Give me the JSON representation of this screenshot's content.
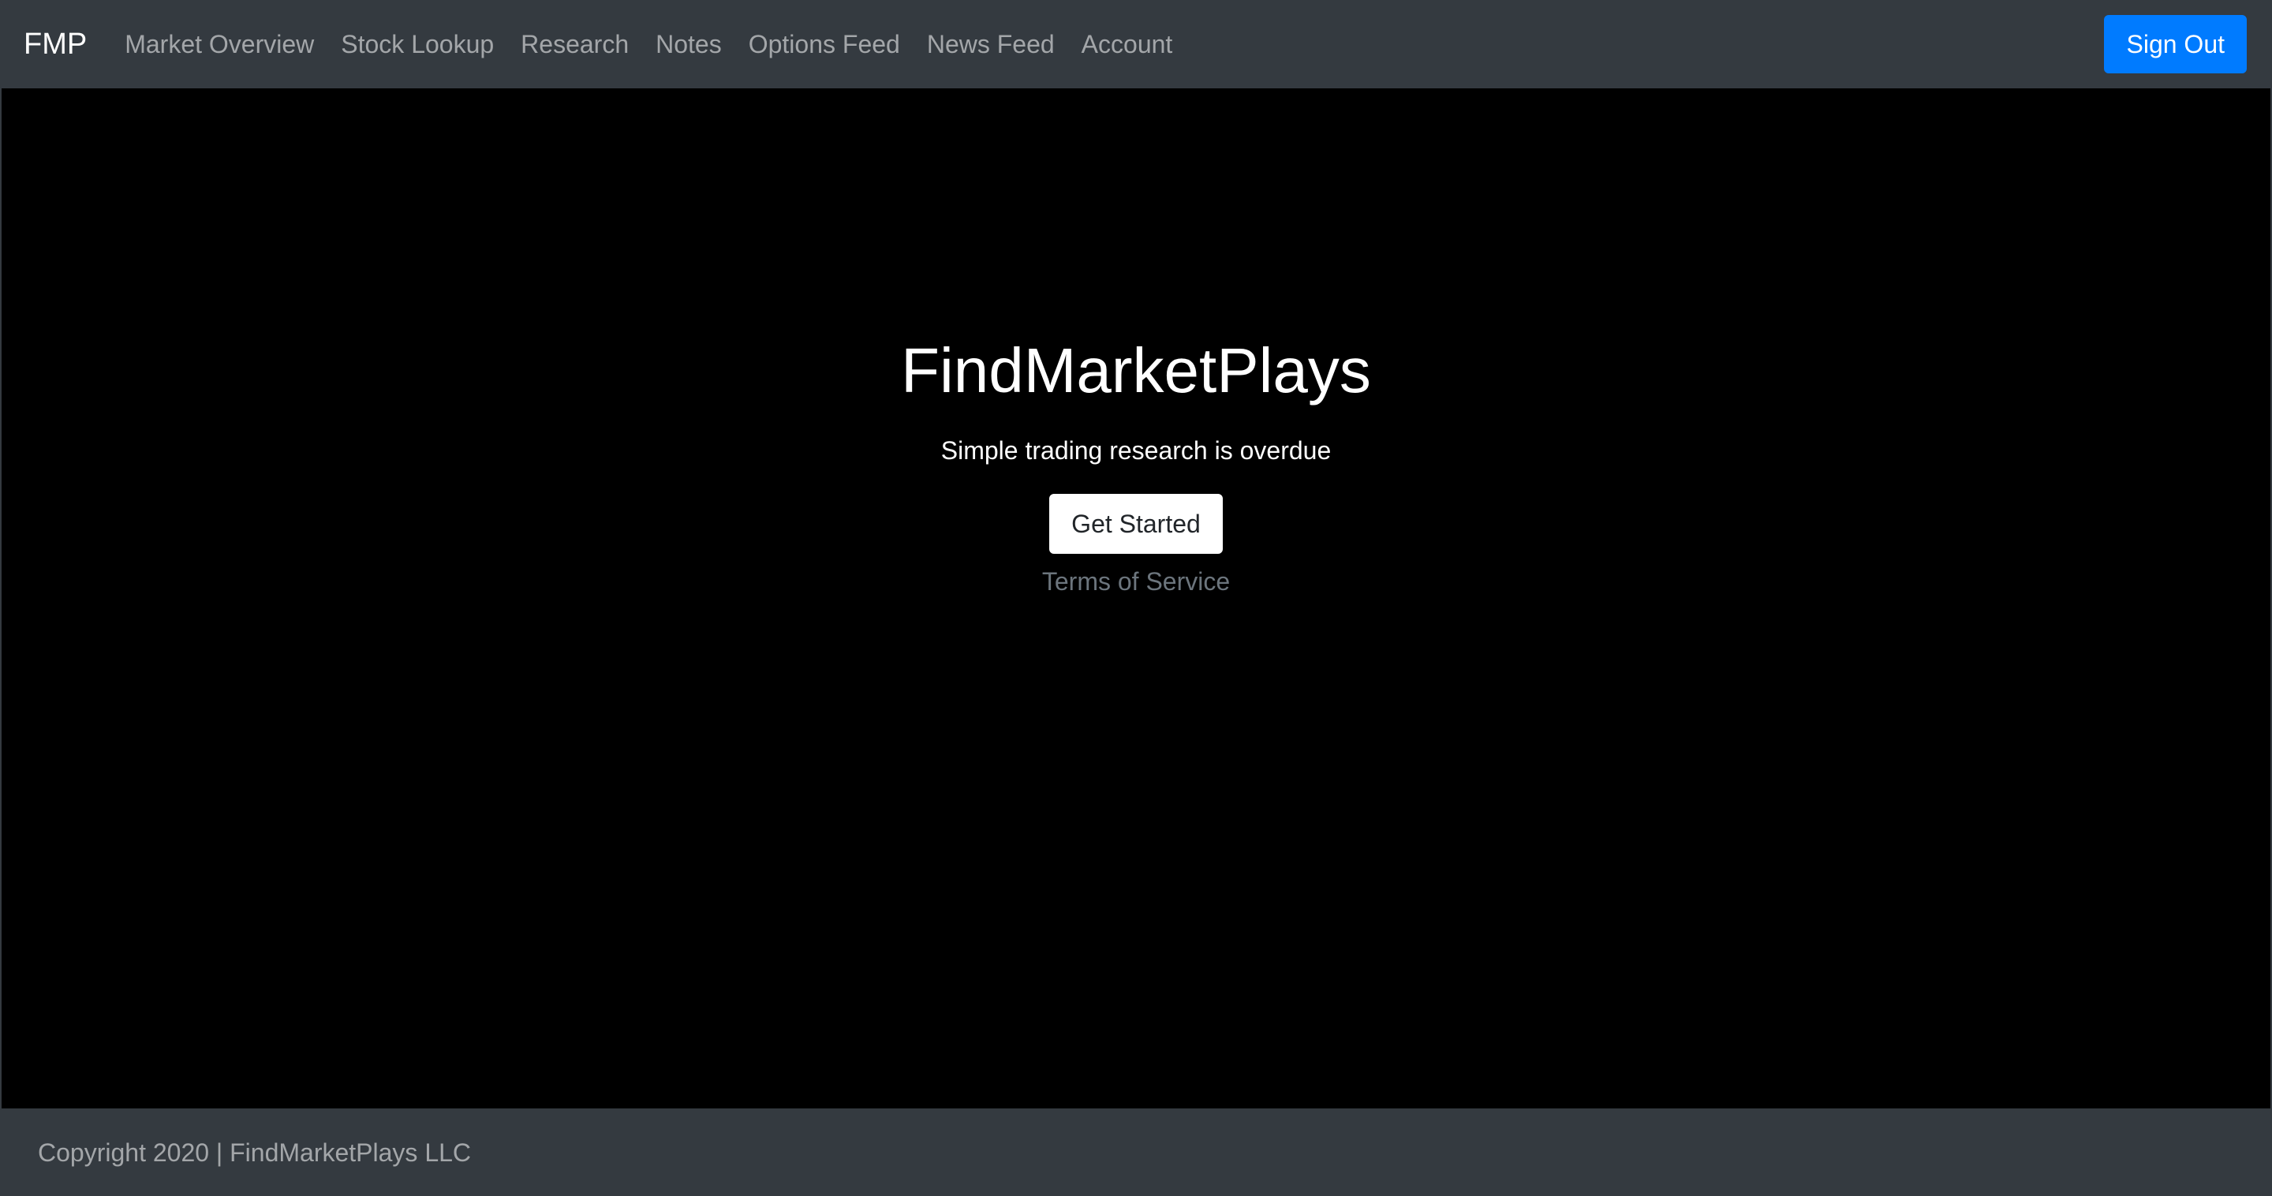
{
  "navbar": {
    "brand": "FMP",
    "links": [
      {
        "label": "Market Overview"
      },
      {
        "label": "Stock Lookup"
      },
      {
        "label": "Research"
      },
      {
        "label": "Notes"
      },
      {
        "label": "Options Feed"
      },
      {
        "label": "News Feed"
      },
      {
        "label": "Account"
      }
    ],
    "sign_out_label": "Sign Out"
  },
  "hero": {
    "title": "FindMarketPlays",
    "subtitle": "Simple trading research is overdue",
    "cta_label": "Get Started",
    "terms_label": "Terms of Service"
  },
  "footer": {
    "copyright": "Copyright 2020 | FindMarketPlays LLC"
  },
  "colors": {
    "navbar_bg": "#343a40",
    "hero_bg": "#000000",
    "primary": "#007bff",
    "muted": "#6c757d"
  }
}
